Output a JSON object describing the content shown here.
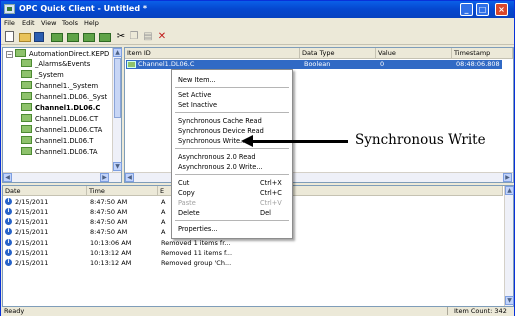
{
  "window": {
    "title": "OPC Quick Client - Untitled *"
  },
  "menu": {
    "items": [
      "File",
      "Edit",
      "View",
      "Tools",
      "Help"
    ]
  },
  "toolbar": {
    "icons": [
      "new-icon",
      "open-icon",
      "save-icon",
      "new-server-icon",
      "new-group-icon",
      "new-item-icon",
      "properties-icon",
      "cut-icon",
      "copy-icon",
      "paste-icon",
      "delete-icon"
    ]
  },
  "tree": {
    "root": "AutomationDirect.KEPD",
    "items": [
      "_Alarms&Events",
      "_System",
      "Channel1._System",
      "Channel1.DL06._Syst",
      "Channel1.DL06.C",
      "Channel1.DL06.CT",
      "Channel1.DL06.CTA",
      "Channel1.DL06.T",
      "Channel1.DL06.TA"
    ]
  },
  "items_pane": {
    "columns": [
      "Item ID",
      "Data Type",
      "Value",
      "Timestamp"
    ],
    "selected_row": {
      "item_id": "Channel1.DL06.C",
      "data_type": "Boolean",
      "value": "0",
      "timestamp": "08:48:06.808"
    }
  },
  "context_menu": {
    "groups": [
      [
        {
          "label": "New Item...",
          "shortcut": "",
          "disabled": false
        }
      ],
      [
        {
          "label": "Set Active",
          "shortcut": "",
          "disabled": false
        },
        {
          "label": "Set Inactive",
          "shortcut": "",
          "disabled": false
        }
      ],
      [
        {
          "label": "Synchronous Cache Read",
          "shortcut": "",
          "disabled": false
        },
        {
          "label": "Synchronous Device Read",
          "shortcut": "",
          "disabled": false
        },
        {
          "label": "Synchronous Write...",
          "shortcut": "",
          "disabled": false
        }
      ],
      [
        {
          "label": "Asynchronous 2.0 Read",
          "shortcut": "",
          "disabled": false
        },
        {
          "label": "Asynchronous 2.0 Write...",
          "shortcut": "",
          "disabled": false
        }
      ],
      [
        {
          "label": "Cut",
          "shortcut": "Ctrl+X",
          "disabled": false
        },
        {
          "label": "Copy",
          "shortcut": "Ctrl+C",
          "disabled": false
        },
        {
          "label": "Paste",
          "shortcut": "Ctrl+V",
          "disabled": true
        },
        {
          "label": "Delete",
          "shortcut": "Del",
          "disabled": false
        }
      ],
      [
        {
          "label": "Properties...",
          "shortcut": "",
          "disabled": false
        }
      ]
    ]
  },
  "log": {
    "columns": [
      "Date",
      "Time",
      "E"
    ],
    "rows": [
      {
        "date": "2/15/2011",
        "time": "8:47:50 AM",
        "event": "A"
      },
      {
        "date": "2/15/2011",
        "time": "8:47:50 AM",
        "event": "A"
      },
      {
        "date": "2/15/2011",
        "time": "8:47:50 AM",
        "event": "A"
      },
      {
        "date": "2/15/2011",
        "time": "8:47:50 AM",
        "event": "A"
      },
      {
        "date": "2/15/2011",
        "time": "10:13:06 AM",
        "event": "Removed 1 items fr..."
      },
      {
        "date": "2/15/2011",
        "time": "10:13:12 AM",
        "event": "Removed 11 items f..."
      },
      {
        "date": "2/15/2011",
        "time": "10:13:12 AM",
        "event": "Removed group 'Ch..."
      }
    ]
  },
  "status": {
    "left": "Ready",
    "right": "Item Count: 342"
  },
  "annotation": {
    "label": "Synchronous Write"
  }
}
